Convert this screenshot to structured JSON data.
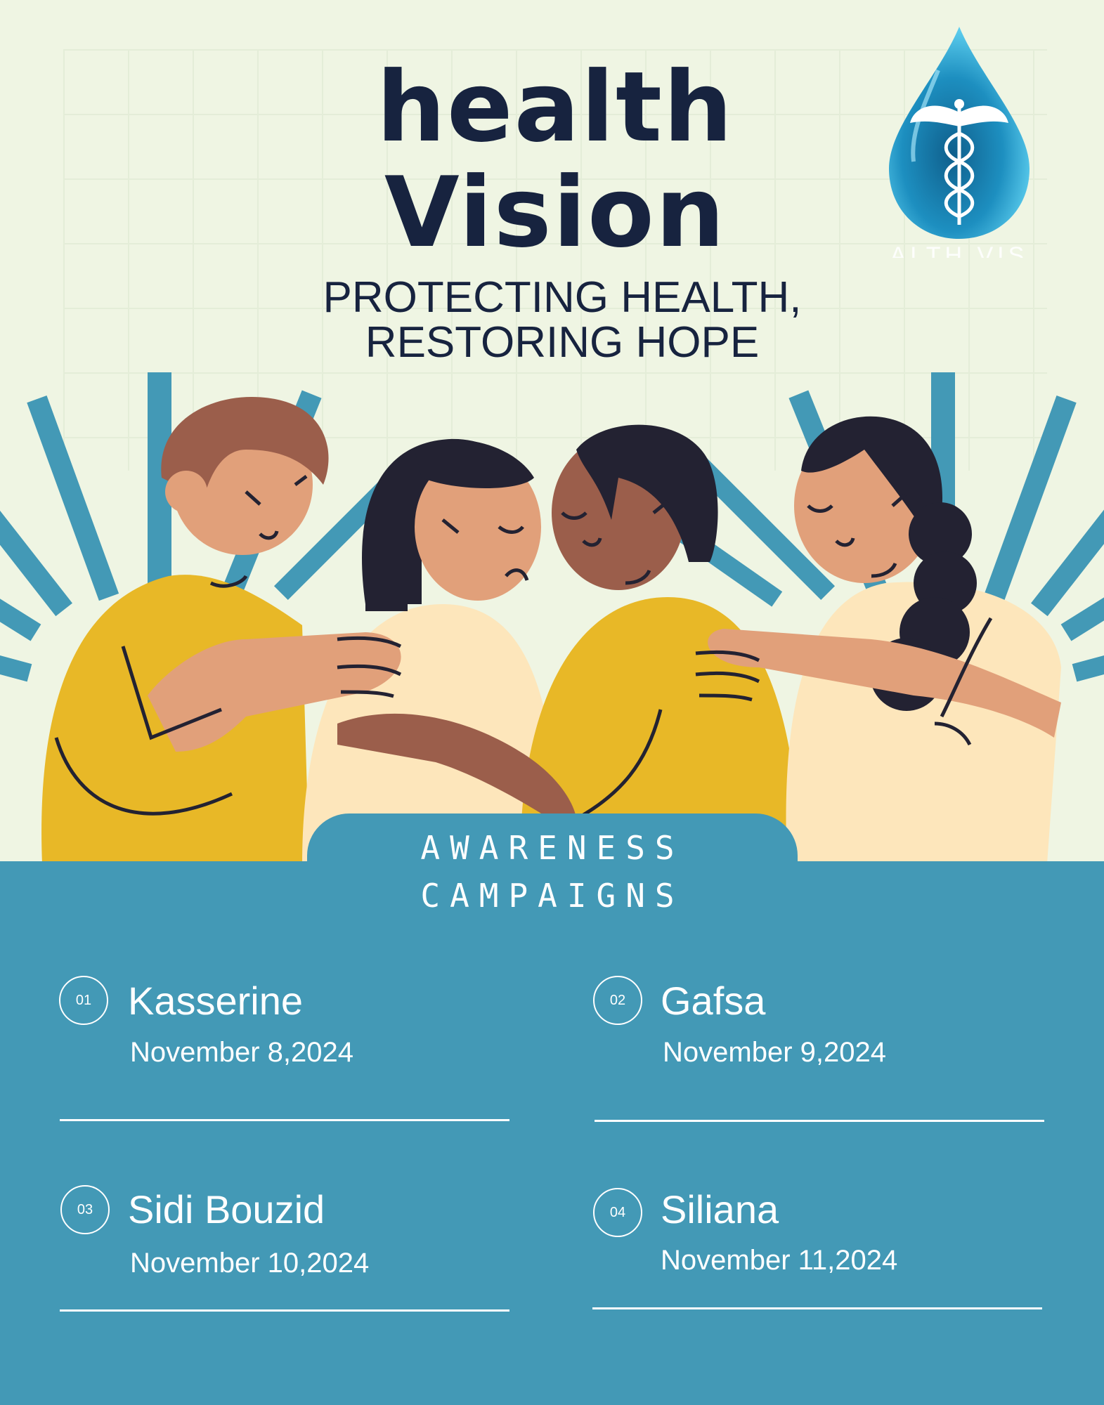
{
  "header": {
    "title_line1": "health",
    "title_line2": "Vision",
    "tagline_line1": "PROTECTING HEALTH,",
    "tagline_line2": "RESTORING HOPE"
  },
  "logo": {
    "icon": "caduceus-water-drop-icon",
    "text": "ALTH VIS"
  },
  "panel": {
    "title_line1": "AWARENESS",
    "title_line2": "CAMPAIGNS"
  },
  "campaigns": [
    {
      "number": "01",
      "place": "Kasserine",
      "date": "November 8,2024"
    },
    {
      "number": "02",
      "place": "Gafsa",
      "date": "November 9,2024"
    },
    {
      "number": "03",
      "place": "Sidi Bouzid",
      "date": "November 10,2024"
    },
    {
      "number": "04",
      "place": "Siliana",
      "date": "November 11,2024"
    }
  ],
  "colors": {
    "background": "#eff5e3",
    "navy": "#17233f",
    "teal": "#4399b6",
    "mustard": "#e8b827",
    "cream": "#fde6bb"
  }
}
